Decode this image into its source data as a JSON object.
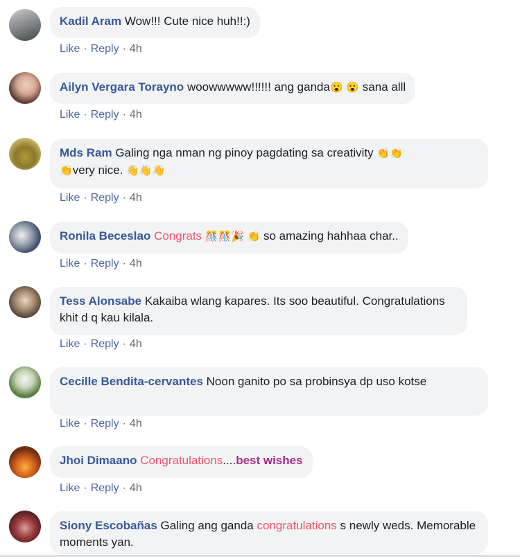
{
  "colors": {
    "name": "#385898",
    "link": "#4b67a1",
    "bubble": "#f2f3f5",
    "highlight": "#f35369",
    "highlight2": "#a72c8a"
  },
  "actions": {
    "like": "Like",
    "reply": "Reply",
    "separator": "·"
  },
  "comments": [
    {
      "name": "Kadil Aram",
      "text": "Wow!!! Cute nice huh!!:)",
      "time": "4h"
    },
    {
      "name": "Ailyn Vergara Torayno",
      "text": "woowwwww!!!!!! ang ganda",
      "emojis": [
        "😮",
        "😮"
      ],
      "text2": "sana alll",
      "time": "4h"
    },
    {
      "name": "Mds Ram",
      "text": "Galing nga nman ng pinoy pagdating sa creativity",
      "emojis": [
        "👏",
        "👏",
        "👏"
      ],
      "text2": "very nice.",
      "emojis2": [
        "👋",
        "👋",
        "👋"
      ],
      "time": "4h"
    },
    {
      "name": "Ronila Beceslao",
      "highlight": "Congrats",
      "emojis": [
        "🎊",
        "🎊",
        "🎉",
        "👏"
      ],
      "text2": "so amazing hahhaa char..",
      "time": "4h"
    },
    {
      "name": "Tess Alonsabe",
      "text": "Kakaiba wlang kapares. Its soo beautiful. Congratulations khit d q kau kilala.",
      "time": "4h"
    },
    {
      "name": "Cecille Bendita-cervantes",
      "text": "Noon ganito po sa probinsya dp uso kotse",
      "time": "4h"
    },
    {
      "name": "Jhoi Dimaano",
      "highlight": "Congratulations",
      "text2": "....",
      "highlight2": "best wishes",
      "time": "4h"
    },
    {
      "name": "Siony Escobañas",
      "text": "Galing ang ganda",
      "highlight": "congratulations",
      "text2": "s newly weds. Memorable moments yan."
    }
  ]
}
